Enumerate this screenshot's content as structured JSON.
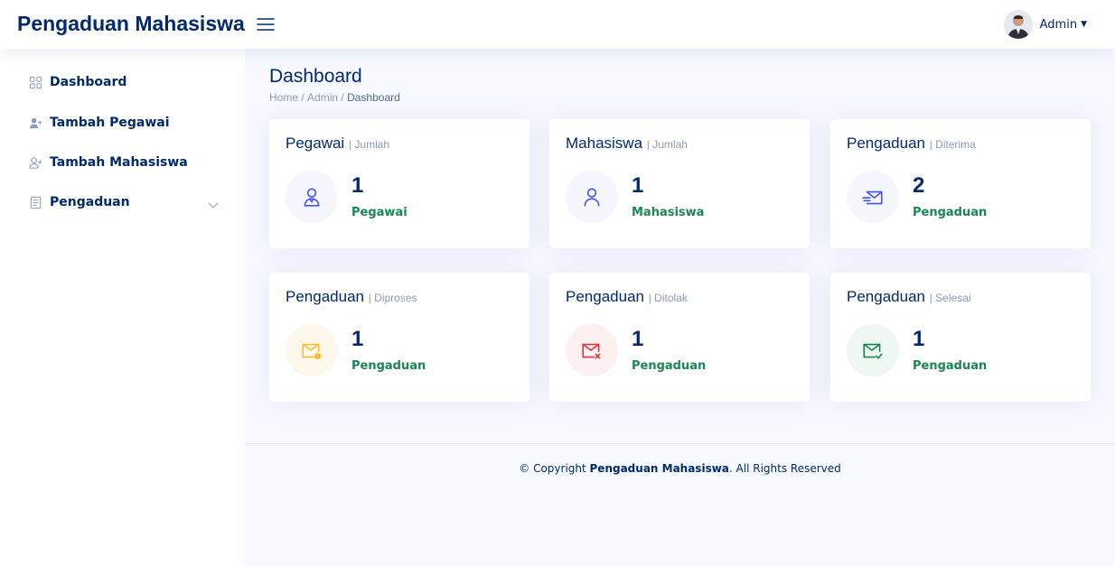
{
  "header": {
    "logo": "Pengaduan Mahasiswa",
    "profile_name": "Admin"
  },
  "sidebar": {
    "items": [
      {
        "label": "Dashboard",
        "icon": "grid-icon"
      },
      {
        "label": "Tambah Pegawai",
        "icon": "person-plus-fill-icon"
      },
      {
        "label": "Tambah Mahasiswa",
        "icon": "person-plus-icon"
      },
      {
        "label": "Pengaduan",
        "icon": "document-icon"
      }
    ]
  },
  "page": {
    "title": "Dashboard",
    "breadcrumb": [
      "Home",
      "Admin",
      "Dashboard"
    ],
    "separator": "/"
  },
  "cards": [
    {
      "title": "Pegawai",
      "subtitle": "| Jumlah",
      "value": "1",
      "label": "Pegawai",
      "icon": "person-badge-icon",
      "color": "#4154f1",
      "bg": "#f6f6fe"
    },
    {
      "title": "Mahasiswa",
      "subtitle": "| Jumlah",
      "value": "1",
      "label": "Mahasiswa",
      "icon": "person-icon",
      "color": "#4154f1",
      "bg": "#f6f6fe"
    },
    {
      "title": "Pengaduan",
      "subtitle": "| Diterima",
      "value": "2",
      "label": "Pengaduan",
      "icon": "envelope-arrow-icon",
      "color": "#4154f1",
      "bg": "#f6f6fe"
    },
    {
      "title": "Pengaduan",
      "subtitle": "| Diproses",
      "value": "1",
      "label": "Pengaduan",
      "icon": "envelope-gear-icon",
      "color": "#ffbb2c",
      "bg": "#fef8ec"
    },
    {
      "title": "Pengaduan",
      "subtitle": "| Ditolak",
      "value": "1",
      "label": "Pengaduan",
      "icon": "envelope-x-icon",
      "color": "#dc3545",
      "bg": "#fdf0f1"
    },
    {
      "title": "Pengaduan",
      "subtitle": "| Selesai",
      "value": "1",
      "label": "Pengaduan",
      "icon": "envelope-check-icon",
      "color": "#198754",
      "bg": "#eef7f1"
    }
  ],
  "footer": {
    "prefix": "© Copyright ",
    "brand": "Pengaduan Mahasiswa",
    "suffix": ". All Rights Reserved"
  }
}
